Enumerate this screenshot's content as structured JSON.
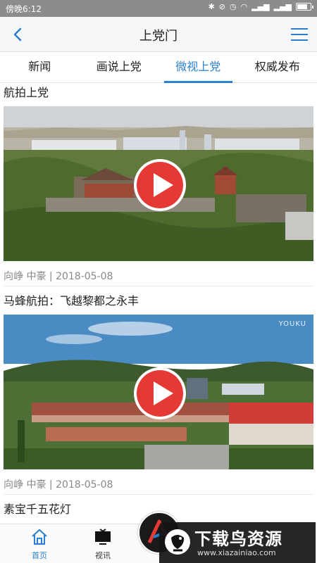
{
  "status_bar": {
    "time": "傍晚6:12",
    "battery_level": 0.8
  },
  "nav": {
    "title": "上党门"
  },
  "tabs": [
    {
      "label": "新闻",
      "active": false
    },
    {
      "label": "画说上党",
      "active": false
    },
    {
      "label": "微视上党",
      "active": true
    },
    {
      "label": "权威发布",
      "active": false
    }
  ],
  "feed": {
    "items": [
      {
        "title": "航拍上党",
        "author": "向峥 中豪",
        "date": "2018-05-08",
        "meta": "向峥 中豪 | 2018-05-08",
        "thumbnail": "aerial-temple-city",
        "watermark": ""
      },
      {
        "title": "马蜂航拍：飞越黎都之永丰",
        "author": "向峥 中豪",
        "date": "2018-05-08",
        "meta": "向峥 中豪 | 2018-05-08",
        "thumbnail": "aerial-village-hills",
        "watermark": "YOUKU"
      },
      {
        "title": "素宝千五花灯",
        "meta": ""
      }
    ]
  },
  "bottom_nav": [
    {
      "label": "首页",
      "icon": "home-icon",
      "active": true
    },
    {
      "label": "视讯",
      "icon": "tv-icon",
      "active": false
    }
  ],
  "overlay_watermark": {
    "text": "下载鸟资源",
    "url": "www.xiazainiao.com"
  },
  "colors": {
    "accent": "#2a7fd0",
    "play": "#e53935",
    "status_bar": "#8c8c8c"
  }
}
